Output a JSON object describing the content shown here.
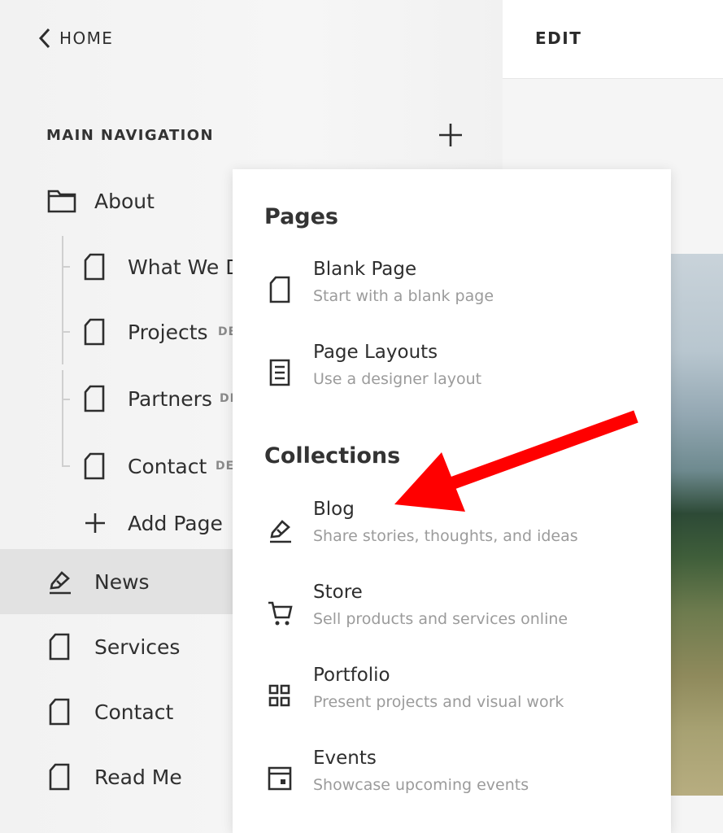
{
  "header": {
    "home_label": "HOME",
    "edit_label": "EDIT"
  },
  "navigation": {
    "heading": "MAIN NAVIGATION",
    "items": [
      {
        "label": "About",
        "icon": "folder-icon"
      },
      {
        "label": "What We D",
        "icon": "page-icon",
        "tag": ""
      },
      {
        "label": "Projects",
        "icon": "page-icon",
        "tag": "DE"
      },
      {
        "label": "Partners",
        "icon": "page-icon",
        "tag": "DI"
      },
      {
        "label": "Contact",
        "icon": "page-icon",
        "tag": "DE"
      },
      {
        "label": "Add Page",
        "icon": "plus-icon"
      },
      {
        "label": "News",
        "icon": "blog-icon"
      },
      {
        "label": "Services",
        "icon": "page-icon"
      },
      {
        "label": "Contact",
        "icon": "page-icon"
      },
      {
        "label": "Read Me",
        "icon": "page-icon"
      }
    ]
  },
  "menu": {
    "pages_heading": "Pages",
    "collections_heading": "Collections",
    "pages": [
      {
        "title": "Blank Page",
        "desc": "Start with a blank page",
        "icon": "page-icon"
      },
      {
        "title": "Page Layouts",
        "desc": "Use a designer layout",
        "icon": "layout-icon"
      }
    ],
    "collections": [
      {
        "title": "Blog",
        "desc": "Share stories, thoughts, and ideas",
        "icon": "blog-icon"
      },
      {
        "title": "Store",
        "desc": "Sell products and services online",
        "icon": "cart-icon"
      },
      {
        "title": "Portfolio",
        "desc": "Present projects and visual work",
        "icon": "grid-icon"
      },
      {
        "title": "Events",
        "desc": "Showcase upcoming events",
        "icon": "calendar-icon"
      }
    ]
  },
  "colors": {
    "arrow": "#ff0000",
    "active_row": "#e2e2e2"
  }
}
